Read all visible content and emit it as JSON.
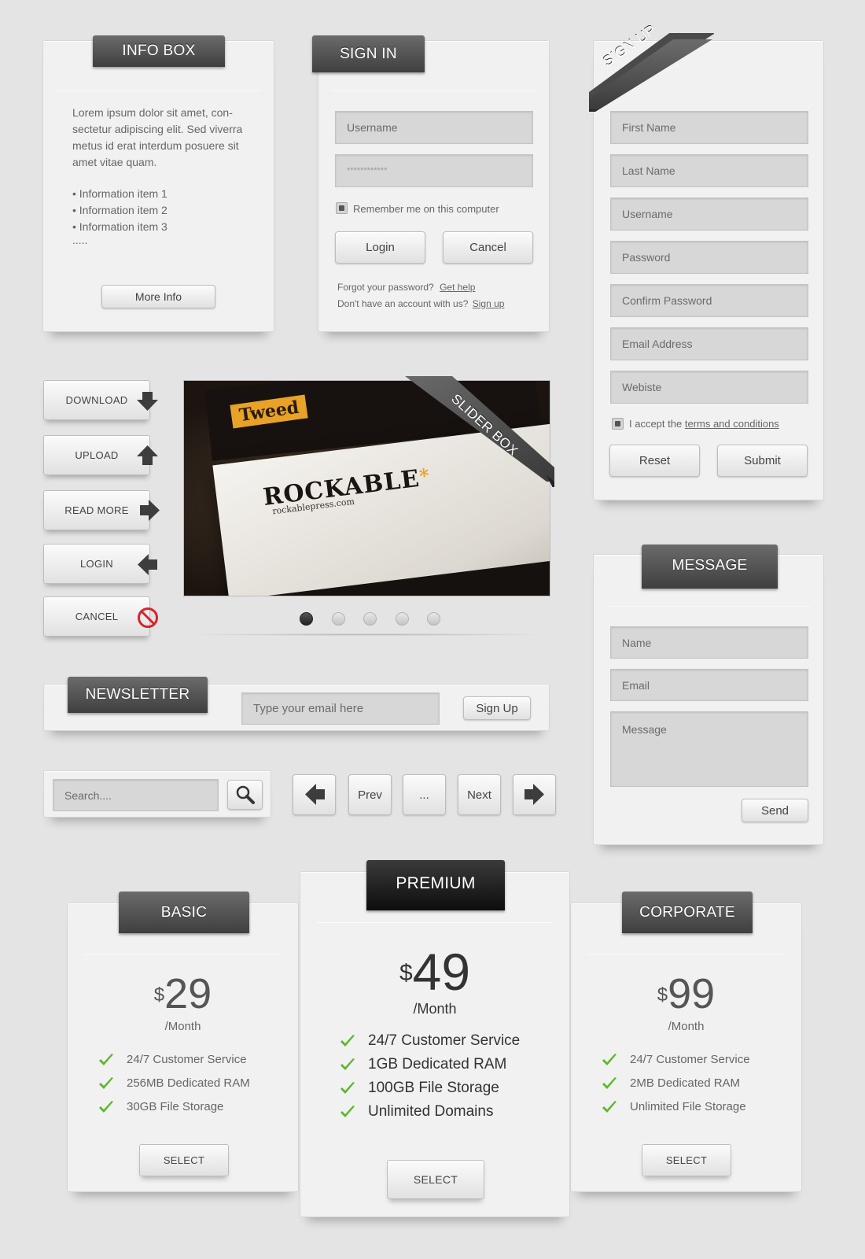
{
  "info_box": {
    "title": "INFO BOX",
    "paragraph": [
      "Lorem ipsum dolor sit amet, con-",
      "sectetur adipiscing elit. Sed viverra",
      "metus id erat interdum posuere sit",
      "amet vitae quam."
    ],
    "items": [
      "• Information item 1",
      "• Information item 2",
      "• Information item 3"
    ],
    "ellipsis": ".....",
    "button": "More Info"
  },
  "sign_in": {
    "title": "SIGN IN",
    "username_placeholder": "Username",
    "password_value": "************",
    "remember": "Remember me on this computer",
    "login": "Login",
    "cancel": "Cancel",
    "forgot_text": "Forgot your password?",
    "forgot_link": "Get help",
    "noaccount_text": "Don't have an account with us?",
    "noaccount_link": "Sign up"
  },
  "sign_up": {
    "ribbon": "SIGN UP",
    "fields": [
      "First Name",
      "Last Name",
      "Username",
      "Password",
      "Confirm Password",
      "Email Address",
      "Webiste"
    ],
    "accept_text": "I accept the",
    "accept_link": "terms and conditions",
    "reset": "Reset",
    "submit": "Submit"
  },
  "action_buttons": [
    "DOWNLOAD",
    "UPLOAD",
    "READ MORE",
    "LOGIN",
    "CANCEL"
  ],
  "slider": {
    "ribbon": "SLIDER BOX",
    "brand": "ROCKABLE",
    "url": "rockablepress.com",
    "label_top": "Tweed",
    "slide_count": 5,
    "active_slide": 1
  },
  "newsletter": {
    "title": "NEWSLETTER",
    "placeholder": "Type your email here",
    "button": "Sign Up"
  },
  "search": {
    "placeholder": "Search...."
  },
  "pagination": {
    "prev": "Prev",
    "ellipsis": "...",
    "next": "Next"
  },
  "message": {
    "title": "MESSAGE",
    "name": "Name",
    "email": "Email",
    "message": "Message",
    "send": "Send"
  },
  "pricing": [
    {
      "title": "BASIC",
      "currency": "$",
      "price": "29",
      "period": "/Month",
      "features": [
        "24/7 Customer Service",
        "256MB Dedicated RAM",
        "30GB File Storage"
      ],
      "button": "SELECT"
    },
    {
      "title": "PREMIUM",
      "currency": "$",
      "price": "49",
      "period": "/Month",
      "features": [
        "24/7 Customer Service",
        "1GB Dedicated RAM",
        "100GB File Storage",
        "Unlimited Domains"
      ],
      "button": "SELECT"
    },
    {
      "title": "CORPORATE",
      "currency": "$",
      "price": "99",
      "period": "/Month",
      "features": [
        "24/7 Customer Service",
        "2MB Dedicated RAM",
        "Unlimited File Storage"
      ],
      "button": "SELECT"
    }
  ],
  "colors": {
    "check": "#5cb82a",
    "tab_dark": "#3f3f3f",
    "cancel_red": "#d9232b"
  }
}
